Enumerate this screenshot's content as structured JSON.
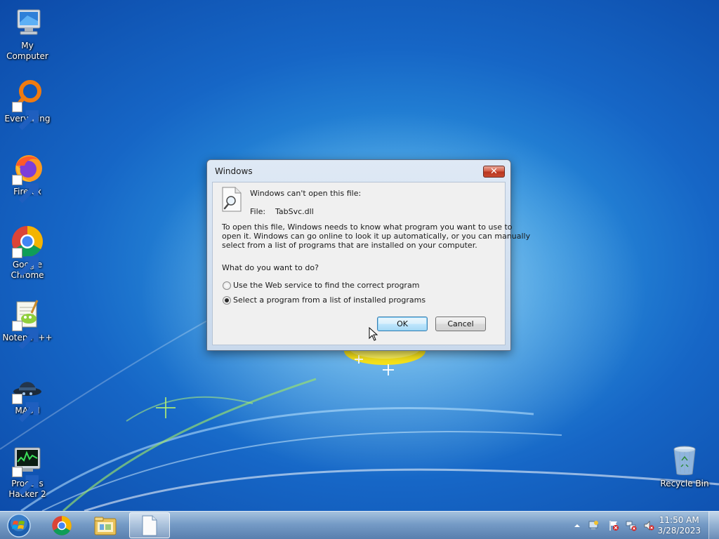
{
  "desktop": {
    "icons": [
      {
        "label": "My Computer"
      },
      {
        "label": "Everything"
      },
      {
        "label": "Firefox"
      },
      {
        "label_line1": "Google",
        "label_line2": "Chrome"
      },
      {
        "label": "Notepad++"
      },
      {
        "label": "MASH"
      },
      {
        "label_line1": "Process",
        "label_line2": "Hacker 2"
      },
      {
        "label": "Recycle Bin"
      }
    ]
  },
  "dialog": {
    "title": "Windows",
    "close_glyph": "✕",
    "heading": "Windows can't open this file:",
    "file_label": "File:",
    "file_name": "TabSvc.dll",
    "paragraph_lines": [
      "To open this file, Windows needs to know what program you want to use to",
      "open it. Windows can go online to look it up automatically, or you can manually",
      "select from a list of programs that are installed on your computer."
    ],
    "question": "What do you want to do?",
    "options": [
      {
        "label": "Use the Web service to find the correct program",
        "selected": false
      },
      {
        "label": "Select a program from a list of installed programs",
        "selected": true
      }
    ],
    "ok_label": "OK",
    "cancel_label": "Cancel"
  },
  "taskbar": {
    "buttons": [
      {
        "icon": "start-orb-icon"
      },
      {
        "icon": "chrome-icon"
      },
      {
        "icon": "file-explorer-icon"
      },
      {
        "icon": "document-icon",
        "active": true
      }
    ],
    "tray_icons": [
      "tray-expand-icon",
      "network-settings-icon",
      "action-center-flag-icon",
      "network-icon",
      "volume-muted-icon"
    ],
    "clock_time": "11:50 AM",
    "clock_date": "3/28/2023"
  },
  "colors": {
    "desktop_blue": "#1666c6",
    "dialog_frame": "#c9d9ec",
    "close_red": "#c84a30",
    "default_button_blue": "#bee6fd"
  }
}
